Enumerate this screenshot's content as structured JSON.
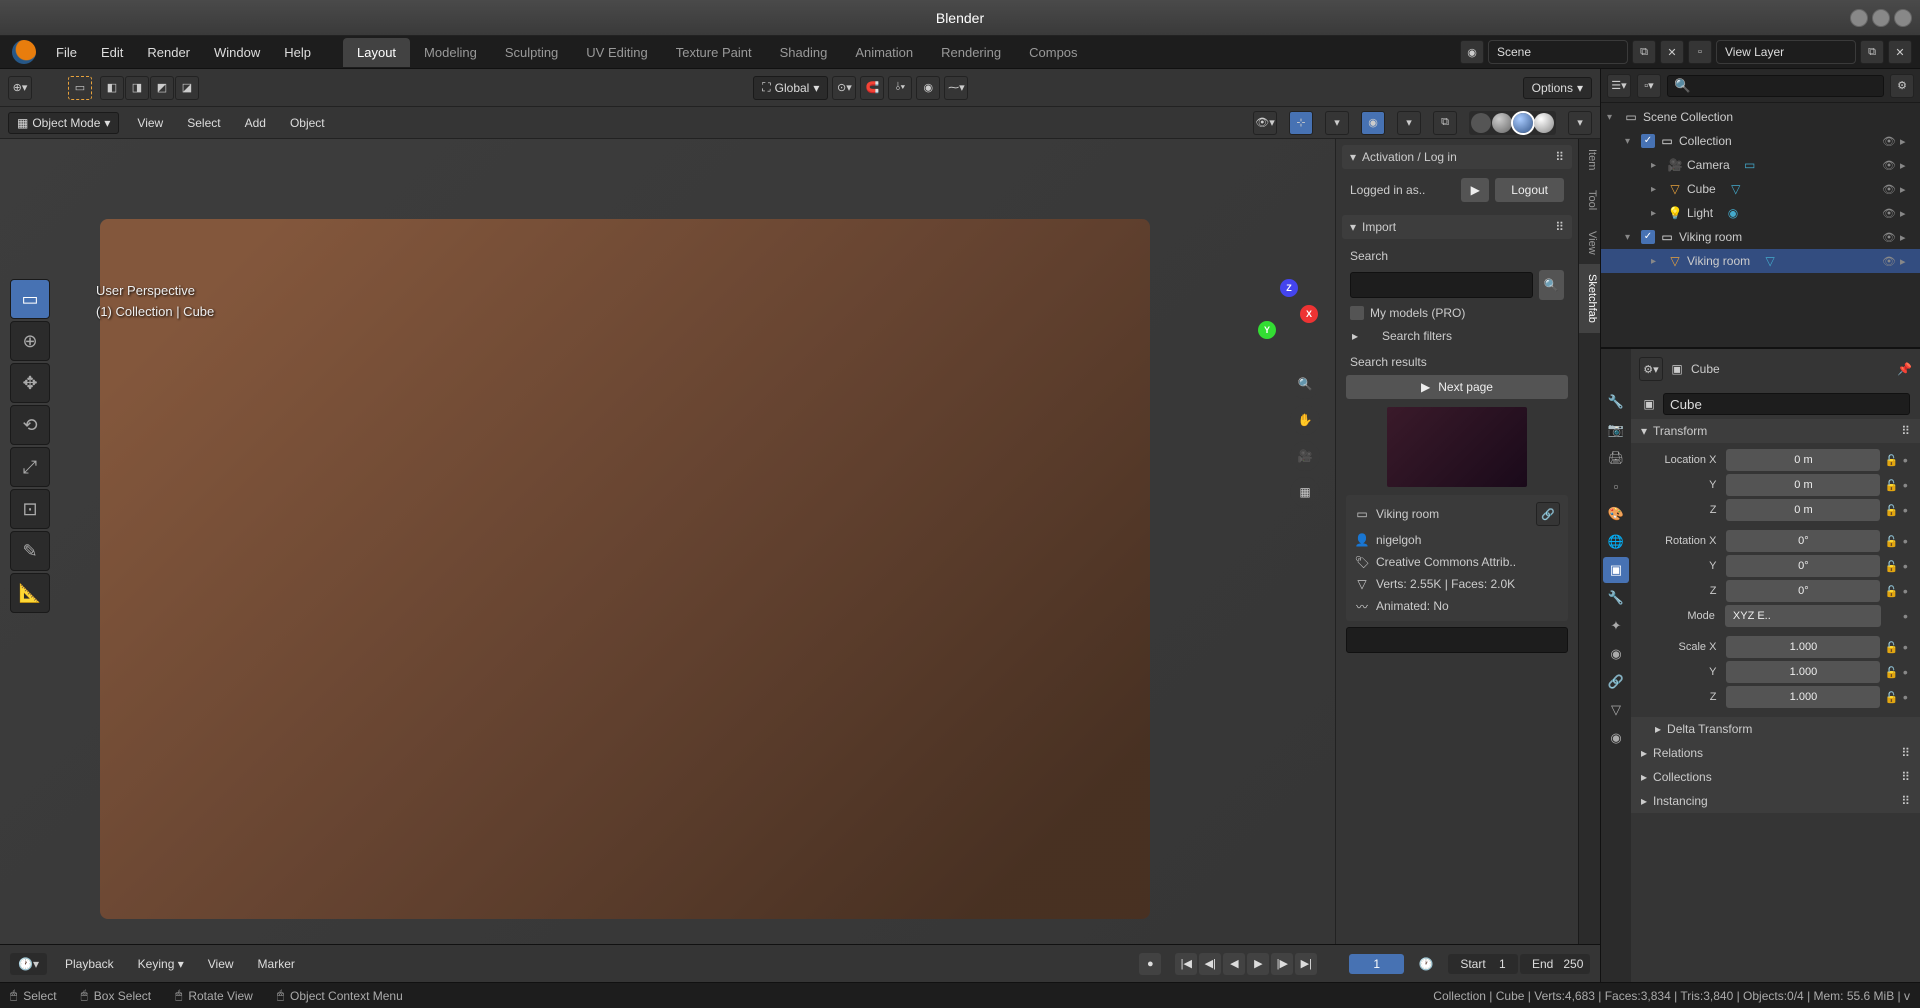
{
  "title": "Blender",
  "menu": [
    "File",
    "Edit",
    "Render",
    "Window",
    "Help"
  ],
  "workspaces": [
    "Layout",
    "Modeling",
    "Sculpting",
    "UV Editing",
    "Texture Paint",
    "Shading",
    "Animation",
    "Rendering",
    "Compos"
  ],
  "scene": {
    "name": "Scene",
    "layer": "View Layer"
  },
  "viewport_header": {
    "orientation": "Global",
    "options": "Options"
  },
  "viewport_header2": {
    "mode": "Object Mode",
    "menus": [
      "View",
      "Select",
      "Add",
      "Object"
    ]
  },
  "overlay": {
    "perspective": "User Perspective",
    "collection": "(1) Collection | Cube"
  },
  "side_tabs": [
    "Item",
    "Tool",
    "View",
    "Sketchfab"
  ],
  "sketchfab": {
    "activation_header": "Activation / Log in",
    "logged_in": "Logged in as..",
    "logout": "Logout",
    "import_header": "Import",
    "search_label": "Search",
    "my_models": "My models (PRO)",
    "filters": "Search filters",
    "results_label": "Search results",
    "next_page": "Next page",
    "model": {
      "name": "Viking room",
      "author": "nigelgoh",
      "license": "Creative Commons Attrib..",
      "stats": "Verts: 2.55K  |  Faces: 2.0K",
      "animated": "Animated: No"
    }
  },
  "outliner": {
    "root": "Scene Collection",
    "items": [
      {
        "name": "Collection",
        "depth": 1,
        "type": "collection",
        "expanded": true,
        "checked": true
      },
      {
        "name": "Camera",
        "depth": 2,
        "type": "camera"
      },
      {
        "name": "Cube",
        "depth": 2,
        "type": "mesh"
      },
      {
        "name": "Light",
        "depth": 2,
        "type": "light"
      },
      {
        "name": "Viking room",
        "depth": 1,
        "type": "collection",
        "expanded": true,
        "checked": true
      },
      {
        "name": "Viking room",
        "depth": 2,
        "type": "mesh",
        "selected": true
      }
    ]
  },
  "properties": {
    "breadcrumb": "Cube",
    "name": "Cube",
    "transform_label": "Transform",
    "location": {
      "label": "Location",
      "x": "0 m",
      "y": "0 m",
      "z": "0 m"
    },
    "rotation": {
      "label": "Rotation",
      "x": "0°",
      "y": "0°",
      "z": "0°"
    },
    "mode": {
      "label": "Mode",
      "value": "XYZ E.."
    },
    "scale": {
      "label": "Scale",
      "x": "1.000",
      "y": "1.000",
      "z": "1.000"
    },
    "sections": [
      "Delta Transform",
      "Relations",
      "Collections",
      "Instancing"
    ]
  },
  "timeline": {
    "menus": [
      "Playback",
      "Keying",
      "View",
      "Marker"
    ],
    "current": "1",
    "start_label": "Start",
    "start": "1",
    "end_label": "End",
    "end": "250"
  },
  "statusbar": {
    "select": "Select",
    "box_select": "Box Select",
    "rotate": "Rotate View",
    "context_menu": "Object Context Menu",
    "stats": "Collection | Cube | Verts:4,683 | Faces:3,834 | Tris:3,840 | Objects:0/4 | Mem: 55.6 MiB | v"
  }
}
